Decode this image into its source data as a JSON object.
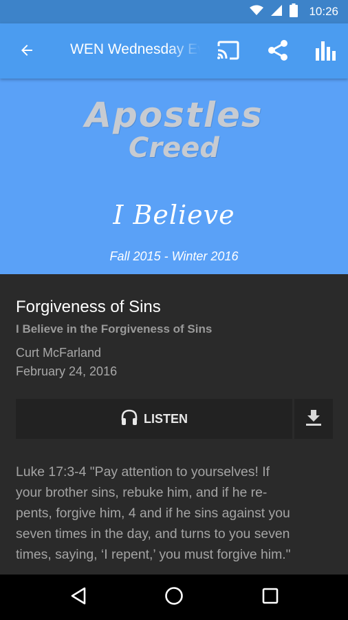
{
  "status_bar": {
    "time": "10:26",
    "icons": [
      "wifi-icon",
      "signal-icon",
      "battery-icon"
    ]
  },
  "toolbar": {
    "title": "WEN Wednesday Evening",
    "actions": [
      "cast-icon",
      "share-icon",
      "equalizer-icon"
    ]
  },
  "hero": {
    "line1": "Apostles",
    "line2": "Creed",
    "tagline": "I Believe",
    "season": "Fall 2015 - Winter 2016"
  },
  "sermon": {
    "title": "Forgiveness of Sins",
    "subtitle": "I Believe in the Forgiveness of Sins",
    "speaker": "Curt McFarland",
    "date": "February 24, 2016"
  },
  "actions": {
    "listen_label": "LISTEN"
  },
  "passage": {
    "lines": [
      "Luke 17:3-4 \"Pay attention to yourselves! If",
      "your brother sins, rebuke him, and if he re-",
      "pents, forgive him, 4 and if he sins against you",
      "seven times in the day, and turns to you seven",
      "times, saying, ‘I repent,’ you must forgive him.\""
    ]
  },
  "colors": {
    "status_bar": "#3d83c9",
    "toolbar": "#4b9cf0",
    "hero": "#5aa1f7",
    "background": "#2a2a2a",
    "button": "#222222"
  }
}
